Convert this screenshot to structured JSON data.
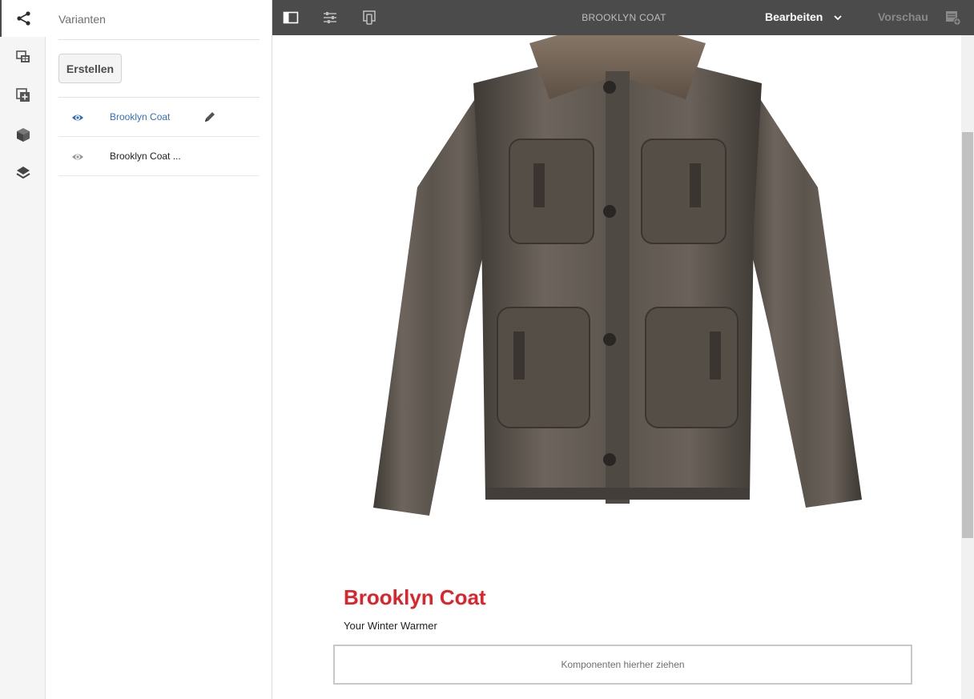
{
  "rail": {
    "items": [
      {
        "icon": "variants-icon",
        "active": true
      },
      {
        "icon": "assets-icon",
        "active": false
      },
      {
        "icon": "components-icon",
        "active": false
      },
      {
        "icon": "product-icon",
        "active": false
      },
      {
        "icon": "layers-icon",
        "active": false
      }
    ]
  },
  "panel": {
    "title": "Varianten",
    "create_label": "Erstellen",
    "variants": [
      {
        "label": "Brooklyn Coat",
        "active": true
      },
      {
        "label": "Brooklyn Coat ...",
        "active": false
      }
    ]
  },
  "toolbar": {
    "page_title": "BROOKLYN COAT",
    "mode_label": "Bearbeiten",
    "preview_label": "Vorschau"
  },
  "content": {
    "product_title": "Brooklyn Coat",
    "product_subtitle": "Your Winter Warmer",
    "dropzone_label": "Komponenten hierher ziehen"
  },
  "colors": {
    "accent_red": "#e0222a",
    "link_blue": "#326ec8",
    "toolbar_bg": "#4b4b4b"
  }
}
